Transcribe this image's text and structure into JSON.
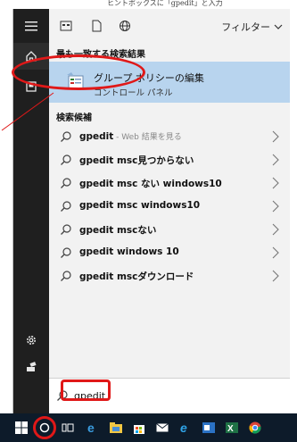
{
  "doc_text": "ヒントボックスに「gpedit」と入力",
  "filterbar": {
    "filter_label": "フィルター"
  },
  "best_match": {
    "header": "最も一致する検索結果",
    "title": "グループ ポリシーの編集",
    "subtitle": "コントロール パネル"
  },
  "suggestions": {
    "header": "検索候補",
    "items": [
      {
        "term": "gpedit",
        "suffix": " - Web 結果を見る"
      },
      {
        "term": "gpedit msc見つからない",
        "suffix": ""
      },
      {
        "term": "gpedit msc ない windows10",
        "suffix": ""
      },
      {
        "term": "gpedit msc windows10",
        "suffix": ""
      },
      {
        "term": "gpedit mscない",
        "suffix": ""
      },
      {
        "term": "gpedit windows 10",
        "suffix": ""
      },
      {
        "term": "gpedit mscダウンロード",
        "suffix": ""
      }
    ]
  },
  "search": {
    "value": "gpedit"
  },
  "colors": {
    "highlight": "#e01818",
    "best_match_bg": "#b8d4ee",
    "rail_bg": "#1f1f1f",
    "taskbar_bg": "#0d1b2a"
  },
  "icons": {
    "rail": [
      "hamburger-icon",
      "home-icon",
      "recent-icon",
      "settings-icon",
      "user-icon"
    ],
    "filterbar": [
      "apps-icon",
      "documents-icon",
      "web-icon",
      "chevron-down-icon"
    ],
    "taskbar": [
      "windows-start-icon",
      "cortana-icon",
      "task-view-icon",
      "edge-icon",
      "explorer-icon",
      "store-icon",
      "mail-icon",
      "ie-icon",
      "outlook-icon",
      "excel-icon",
      "chrome-icon"
    ]
  }
}
